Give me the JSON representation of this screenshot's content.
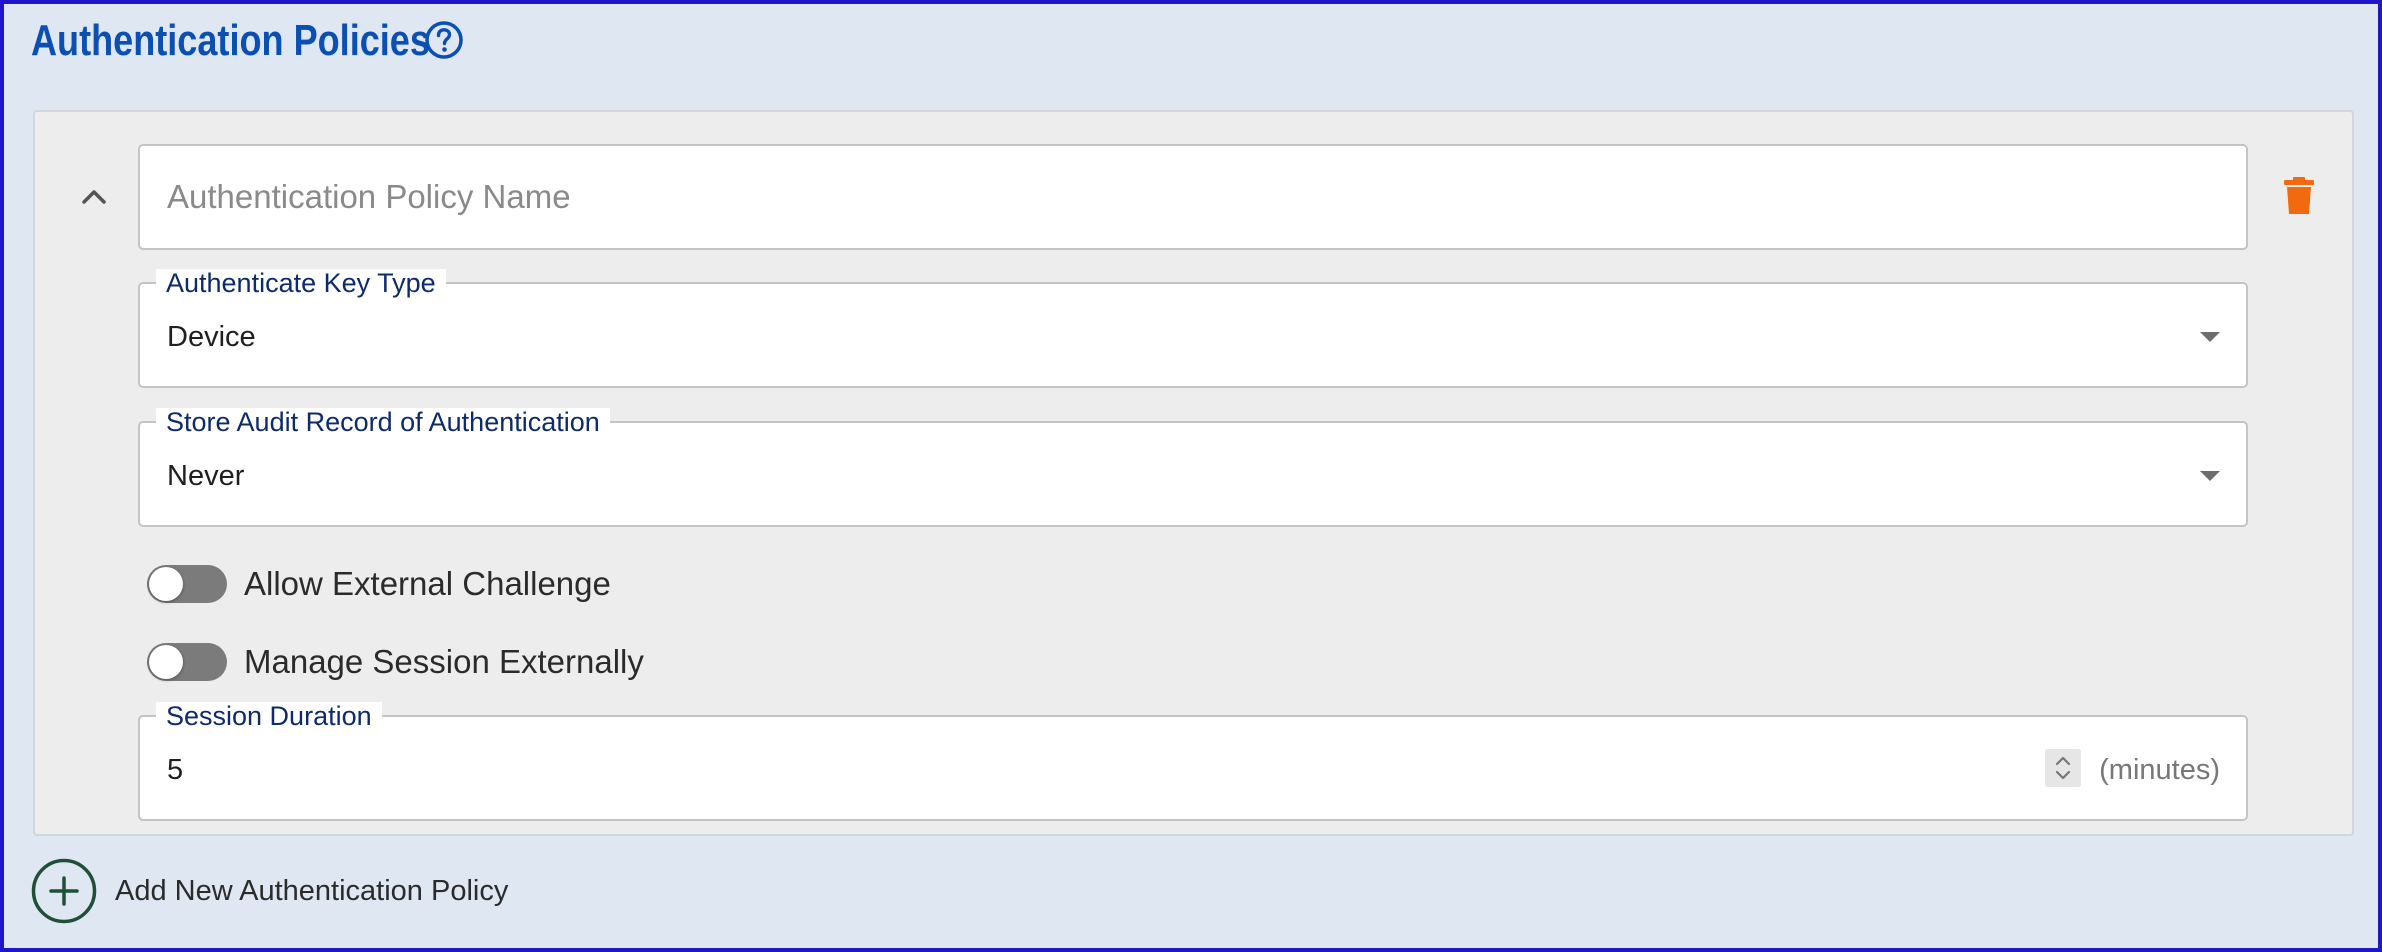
{
  "header": {
    "title": "Authentication Policies",
    "help_icon": "help-circle-icon"
  },
  "policy": {
    "collapse_icon": "chevron-up-icon",
    "delete_icon": "trash-icon",
    "name_field": {
      "placeholder": "Authentication Policy Name",
      "value": ""
    },
    "key_type": {
      "label": "Authenticate Key Type",
      "value": "Device"
    },
    "audit_record": {
      "label": "Store Audit Record of Authentication",
      "value": "Never"
    },
    "allow_external_challenge": {
      "label": "Allow External Challenge",
      "enabled": false
    },
    "manage_session_externally": {
      "label": "Manage Session Externally",
      "enabled": false
    },
    "session_duration": {
      "label": "Session Duration",
      "value": "5",
      "unit": "(minutes)"
    }
  },
  "add_policy": {
    "label": "Add New Authentication Policy",
    "icon": "plus-circle-icon"
  },
  "colors": {
    "title_blue": "#0b4fb3",
    "frame_border": "#1d17c9",
    "background": "#dfe7f3",
    "card": "#ededed",
    "delete_orange": "#f26a10",
    "add_green": "#1f4f37"
  }
}
